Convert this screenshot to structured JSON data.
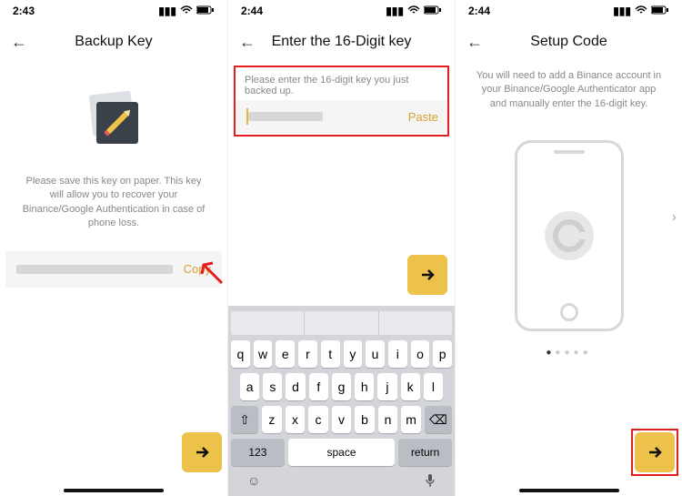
{
  "screens": [
    {
      "status_time": "2:43",
      "title": "Backup Key",
      "description": "Please save this key on paper. This key will allow you to recover your Binance/Google Authentication in case of phone loss.",
      "copy_label": "Copy"
    },
    {
      "status_time": "2:44",
      "title": "Enter the 16-Digit key",
      "instruction": "Please enter the 16-digit key you just backed up.",
      "paste_label": "Paste",
      "keyboard": {
        "row1": [
          "q",
          "w",
          "e",
          "r",
          "t",
          "y",
          "u",
          "i",
          "o",
          "p"
        ],
        "row2": [
          "a",
          "s",
          "d",
          "f",
          "g",
          "h",
          "j",
          "k",
          "l"
        ],
        "row3": [
          "z",
          "x",
          "c",
          "v",
          "b",
          "n",
          "m"
        ],
        "num_label": "123",
        "space_label": "space",
        "return_label": "return"
      }
    },
    {
      "status_time": "2:44",
      "title": "Setup Code",
      "description": "You will need to add a Binance account in your Binance/Google Authenticator app and manually enter the 16-digit key."
    }
  ],
  "colors": {
    "accent": "#ecc24b",
    "link": "#d7a32e",
    "highlight": "#e21e1e"
  }
}
